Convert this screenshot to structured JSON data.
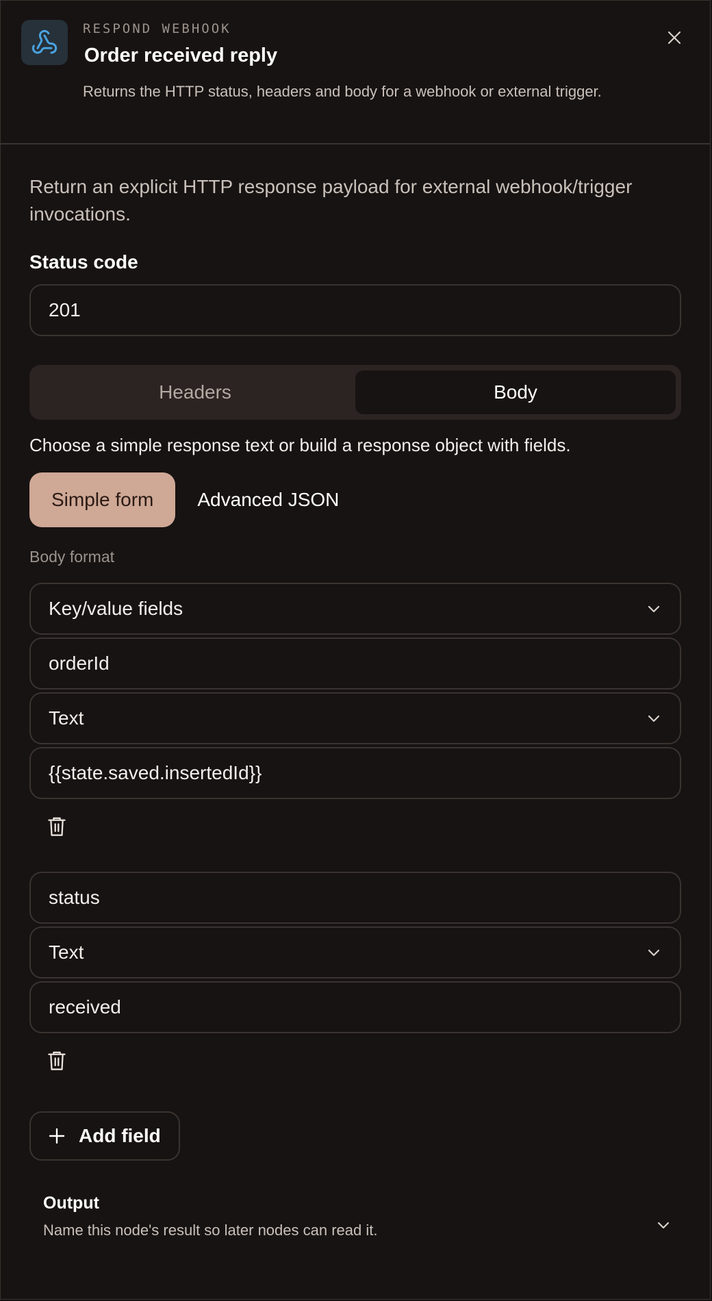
{
  "header": {
    "eyebrow": "RESPOND WEBHOOK",
    "title": "Order received reply",
    "subtitle": "Returns the HTTP status, headers and body for a webhook or external trigger.",
    "icon": "webhook-icon"
  },
  "description": "Return an explicit HTTP response payload for external webhook/trigger invocations.",
  "status_code": {
    "label": "Status code",
    "value": "201"
  },
  "tabs": {
    "headers": "Headers",
    "body": "Body",
    "active": "Body"
  },
  "body": {
    "hint": "Choose a simple response text or build a response object with fields.",
    "modes": {
      "simple": "Simple form",
      "advanced": "Advanced JSON",
      "active": "Simple form"
    },
    "format_label": "Body format",
    "format_value": "Key/value fields",
    "fields": [
      {
        "key": "orderId",
        "type": "Text",
        "value": "{{state.saved.insertedId}}"
      },
      {
        "key": "status",
        "type": "Text",
        "value": "received"
      }
    ],
    "add_label": "Add field"
  },
  "output": {
    "title": "Output",
    "subtitle": "Name this node's result so later nodes can read it."
  },
  "colors": {
    "accent": "#cfa896",
    "background": "#171312",
    "border": "#3a3330",
    "icon": "#4aa3e0"
  }
}
